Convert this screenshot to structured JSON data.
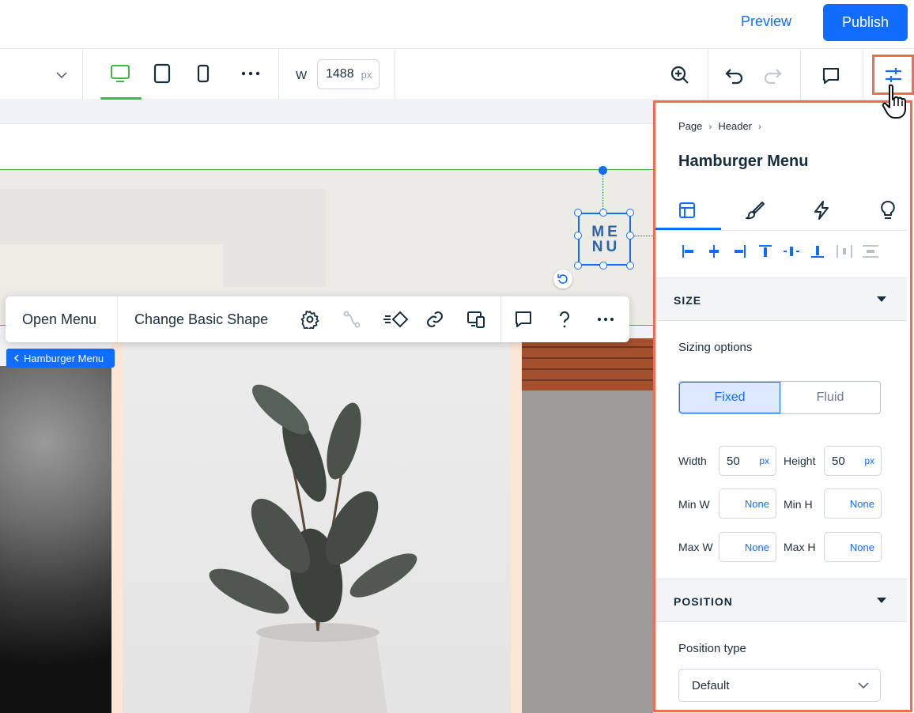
{
  "topbar": {
    "preview_label": "Preview",
    "publish_label": "Publish"
  },
  "toolbar": {
    "width_label": "W",
    "width_value": "1488",
    "width_unit": "px",
    "icons": [
      "chevron-down-icon",
      "desktop-icon",
      "tablet-icon",
      "mobile-icon",
      "more-icon",
      "zoom-in-icon",
      "undo-icon",
      "redo-icon",
      "comment-icon",
      "inspector-icon"
    ]
  },
  "canvas": {
    "menu_line1": "ME",
    "menu_line2": "NU",
    "action_bar": {
      "open_menu": "Open Menu",
      "change_shape": "Change Basic Shape",
      "icons": [
        "settings-icon",
        "animation-path-icon",
        "animation-icon",
        "link-icon",
        "responsive-icon",
        "comment-icon",
        "help-icon",
        "more-icon"
      ]
    },
    "element_chip": "Hamburger Menu"
  },
  "inspector": {
    "breadcrumb": [
      "Page",
      "Header"
    ],
    "title": "Hamburger Menu",
    "tabs": [
      "layout-icon",
      "design-icon",
      "interactions-icon",
      "tips-icon"
    ],
    "size": {
      "header": "SIZE",
      "sizing_options_label": "Sizing options",
      "options": [
        "Fixed",
        "Fluid"
      ],
      "selected": "Fixed",
      "width_label": "Width",
      "width_value": "50",
      "width_unit": "px",
      "height_label": "Height",
      "height_value": "50",
      "height_unit": "px",
      "min_w_label": "Min W",
      "min_w_value": "None",
      "min_h_label": "Min H",
      "min_h_value": "None",
      "max_w_label": "Max W",
      "max_w_value": "None",
      "max_h_label": "Max H",
      "max_h_value": "None"
    },
    "position": {
      "header": "POSITION",
      "position_type_label": "Position type",
      "position_type_value": "Default"
    }
  },
  "colors": {
    "accent": "#116dff",
    "highlight": "#f26b52",
    "guide_green": "#3cbc3c"
  }
}
